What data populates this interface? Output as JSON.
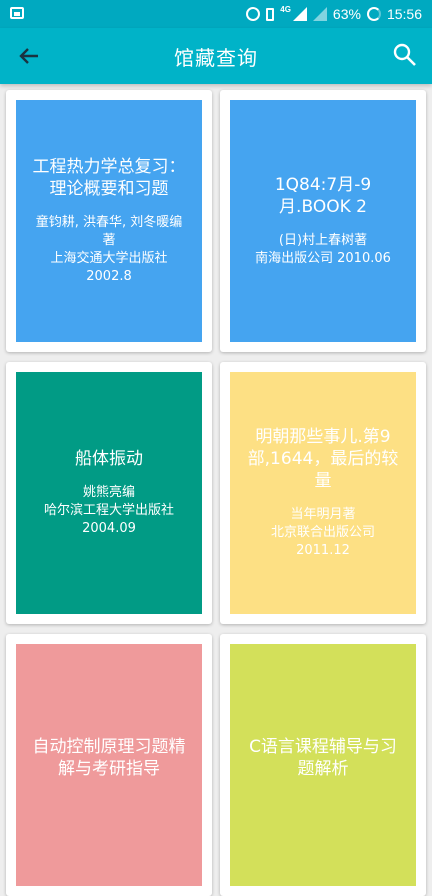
{
  "status": {
    "battery": "63%",
    "time": "15:56",
    "network": "4G"
  },
  "appbar": {
    "title": "馆藏查询"
  },
  "books": [
    {
      "title": "工程热力学总复习：理论概要和习题",
      "author": "童钧耕, 洪春华, 刘冬暖编著",
      "publisher": "上海交通大学出版社",
      "date": "2002.8",
      "color": "#45a4f0"
    },
    {
      "title": "1Q84:7月-9月.BOOK 2",
      "author": "(日)村上春树著",
      "publisher": "南海出版公司",
      "date": "2010.06",
      "color": "#45a4f0"
    },
    {
      "title": "船体振动",
      "author": "姚熊亮编",
      "publisher": "哈尔滨工程大学出版社",
      "date": "2004.09",
      "color": "#019b85"
    },
    {
      "title": "明朝那些事儿.第9部,1644，最后的较量",
      "author": "当年明月著",
      "publisher": "北京联合出版公司",
      "date": "2011.12",
      "color": "#fde084"
    },
    {
      "title": "自动控制原理习题精解与考研指导",
      "author": "",
      "publisher": "",
      "date": "",
      "color": "#ef9a9b"
    },
    {
      "title": "C语言课程辅导与习题解析",
      "author": "",
      "publisher": "",
      "date": "",
      "color": "#d3e05a"
    }
  ]
}
